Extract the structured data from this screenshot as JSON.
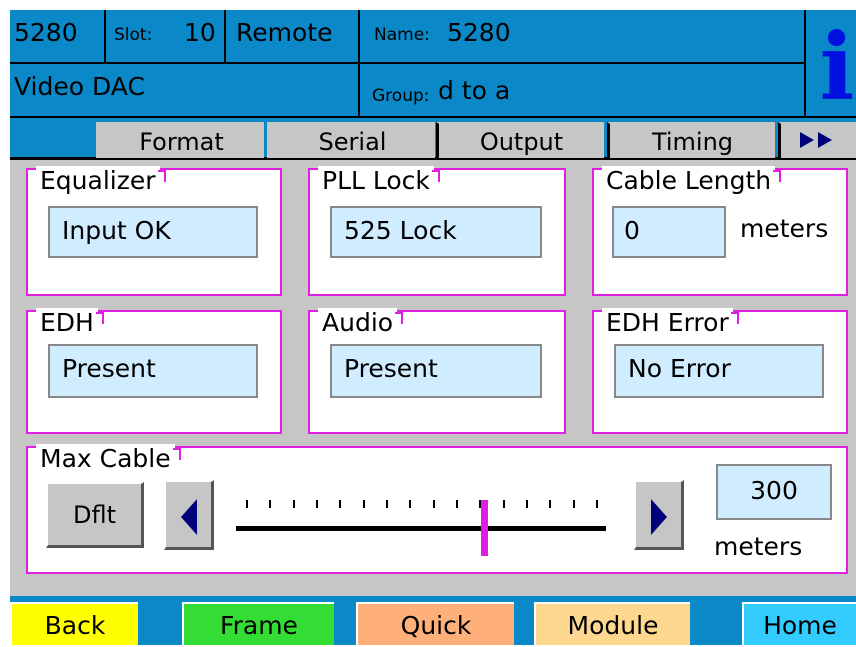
{
  "header": {
    "model": "5280",
    "slot_label": "Slot:",
    "slot_value": "10",
    "mode": "Remote",
    "name_label": "Name:",
    "name_value": "5280",
    "device_type": "Video DAC",
    "group_label": "Group:",
    "group_value": "d to a",
    "info_glyph": "i"
  },
  "tabs": [
    {
      "label": "Format"
    },
    {
      "label": "Serial",
      "selected": true
    },
    {
      "label": "Output"
    },
    {
      "label": "Timing"
    },
    {
      "label": "▸▸",
      "icon": "double-arrow-right-icon"
    }
  ],
  "panels": {
    "equalizer": {
      "title": "Equalizer",
      "value": "Input OK"
    },
    "pll_lock": {
      "title": "PLL Lock",
      "value": "525 Lock"
    },
    "cable_length": {
      "title": "Cable Length",
      "value": "0",
      "unit": "meters"
    },
    "edh": {
      "title": "EDH",
      "value": "Present"
    },
    "audio": {
      "title": "Audio",
      "value": "Present"
    },
    "edh_error": {
      "title": "EDH Error",
      "value": "No Error"
    }
  },
  "max_cable": {
    "title": "Max Cable",
    "default_label": "Dflt",
    "value": "300",
    "unit": "meters",
    "slider_fraction": 0.68,
    "tick_count": 16
  },
  "footer": {
    "back": "Back",
    "frame": "Frame",
    "quick": "Quick",
    "module": "Module",
    "home": "Home"
  },
  "colors": {
    "header_blue": "#0a88c8",
    "panel_border": "#e020e0",
    "field_fill": "#d0ecff",
    "back": "#ffff00",
    "frame": "#33dd33",
    "quick": "#ffb07a",
    "module": "#ffd890",
    "home": "#33ccff",
    "arrow": "#00007a"
  }
}
